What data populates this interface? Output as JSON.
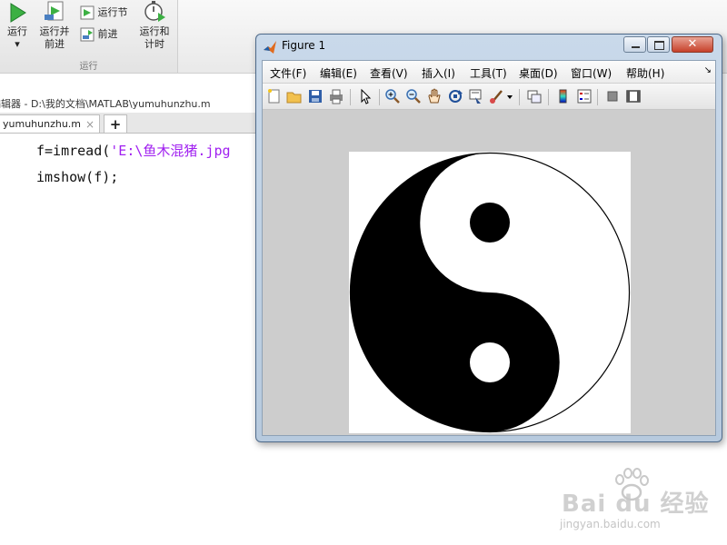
{
  "ribbon": {
    "buttons": {
      "run": {
        "label": "运行",
        "sub": "▾"
      },
      "run_advance": {
        "label": "运行并",
        "sub": "前进"
      },
      "run_section": {
        "label": "运行节"
      },
      "advance": {
        "label": "前进"
      },
      "run_time": {
        "label": "运行和",
        "sub": "计时"
      }
    },
    "group_label": "运行"
  },
  "editor": {
    "title": "编辑器 - D:\\我的文档\\MATLAB\\yumuhunzhu.m",
    "tab_label": "yumuhunzhu.m",
    "tab_close": "×",
    "tab_add": "+",
    "code": {
      "line1_prefix": "f=imread(",
      "line1_string": "'E:\\鱼木混猪.jpg",
      "line2": "imshow(f);"
    }
  },
  "figure": {
    "title": "Figure 1",
    "close_glyph": "✕",
    "menus": [
      "文件(F)",
      "编辑(E)",
      "查看(V)",
      "插入(I)",
      "工具(T)",
      "桌面(D)",
      "窗口(W)",
      "帮助(H)"
    ],
    "menu_more": "↘",
    "image": {
      "description_icon": "yin-yang",
      "fill": "#000000",
      "background": "#ffffff"
    }
  },
  "watermark": {
    "brand": "Bai du 经验",
    "url": "jingyan.baidu.com"
  },
  "colors": {
    "string_color": "#a020f0",
    "titlebar": "#c9d9ea",
    "close_button": "#c7402a"
  }
}
